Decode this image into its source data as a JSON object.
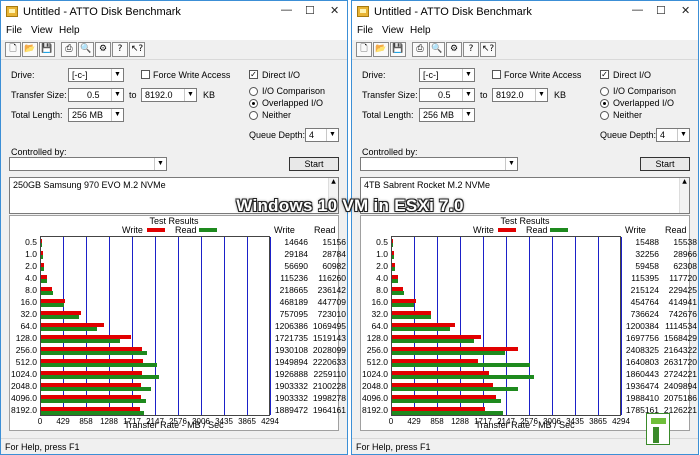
{
  "overlay_text": "Windows 10 VM in ESXi 7.0",
  "windows": [
    {
      "title": "Untitled - ATTO Disk Benchmark",
      "menus": [
        "File",
        "View",
        "Help"
      ],
      "drive_label": "Drive:",
      "drive_value": "[-c-]",
      "force_write_access": "Force Write Access",
      "direct_io": "Direct I/O",
      "transfer_size_label": "Transfer Size:",
      "transfer_from": "0.5",
      "to_label": "to",
      "transfer_to": "8192.0",
      "kb_label": "KB",
      "io_comparison": "I/O Comparison",
      "overlapped_io": "Overlapped I/O",
      "neither": "Neither",
      "total_length_label": "Total Length:",
      "total_length": "256 MB",
      "queue_depth_label": "Queue Depth:",
      "queue_depth": "4",
      "controlled_by_label": "Controlled by:",
      "start_label": "Start",
      "description": "250GB Samsung 970 EVO M.2 NVMe",
      "status": "For Help, press F1",
      "chart_data": {
        "type": "bar",
        "title": "Test Results",
        "legend": [
          "Write",
          "Read"
        ],
        "xlabel": "Transfer Rate - MB / Sec",
        "xlim": [
          0,
          4294
        ],
        "xticks": [
          "0",
          "429",
          "858",
          "1288",
          "1717",
          "2147",
          "2576",
          "3006",
          "3435",
          "3865",
          "4294"
        ],
        "categories": [
          "0.5",
          "1.0",
          "2.0",
          "4.0",
          "8.0",
          "16.0",
          "32.0",
          "64.0",
          "128.0",
          "256.0",
          "512.0",
          "1024.0",
          "2048.0",
          "4096.0",
          "8192.0"
        ],
        "series": [
          {
            "name": "Write",
            "values": [
              14646,
              29184,
              56690,
              115236,
              218665,
              468189,
              757095,
              1206386,
              1721735,
              1930108,
              1949894,
              1926888,
              1903332,
              1903332,
              1889472
            ]
          },
          {
            "name": "Read",
            "values": [
              15156,
              28784,
              60982,
              116260,
              236142,
              447709,
              723010,
              1069495,
              1519143,
              2028099,
              2220633,
              2259110,
              2100228,
              1998278,
              1964161
            ]
          }
        ]
      }
    },
    {
      "title": "Untitled - ATTO Disk Benchmark",
      "menus": [
        "File",
        "View",
        "Help"
      ],
      "drive_label": "Drive:",
      "drive_value": "[-c-]",
      "force_write_access": "Force Write Access",
      "direct_io": "Direct I/O",
      "transfer_size_label": "Transfer Size:",
      "transfer_from": "0.5",
      "to_label": "to",
      "transfer_to": "8192.0",
      "kb_label": "KB",
      "io_comparison": "I/O Comparison",
      "overlapped_io": "Overlapped I/O",
      "neither": "Neither",
      "total_length_label": "Total Length:",
      "total_length": "256 MB",
      "queue_depth_label": "Queue Depth:",
      "queue_depth": "4",
      "controlled_by_label": "Controlled by:",
      "start_label": "Start",
      "description": "4TB Sabrent Rocket M.2 NVMe",
      "status": "For Help, press F1",
      "chart_data": {
        "type": "bar",
        "title": "Test Results",
        "legend": [
          "Write",
          "Read"
        ],
        "xlabel": "Transfer Rate - MB / Sec",
        "xlim": [
          0,
          4294
        ],
        "xticks": [
          "0",
          "429",
          "858",
          "1288",
          "1717",
          "2147",
          "2576",
          "3006",
          "3435",
          "3865",
          "4294"
        ],
        "categories": [
          "0.5",
          "1.0",
          "2.0",
          "4.0",
          "8.0",
          "16.0",
          "32.0",
          "64.0",
          "128.0",
          "256.0",
          "512.0",
          "1024.0",
          "2048.0",
          "4096.0",
          "8192.0"
        ],
        "series": [
          {
            "name": "Write",
            "values": [
              15488,
              32256,
              59458,
              115395,
              215124,
              454764,
              736624,
              1200384,
              1697756,
              2408325,
              1640803,
              1860443,
              1936474,
              1988410,
              1785161
            ]
          },
          {
            "name": "Read",
            "values": [
              15538,
              28966,
              62308,
              117720,
              229425,
              414941,
              742676,
              1114534,
              1568429,
              2164322,
              2631720,
              2724221,
              2409894,
              2075186,
              2126221
            ]
          }
        ]
      }
    }
  ]
}
